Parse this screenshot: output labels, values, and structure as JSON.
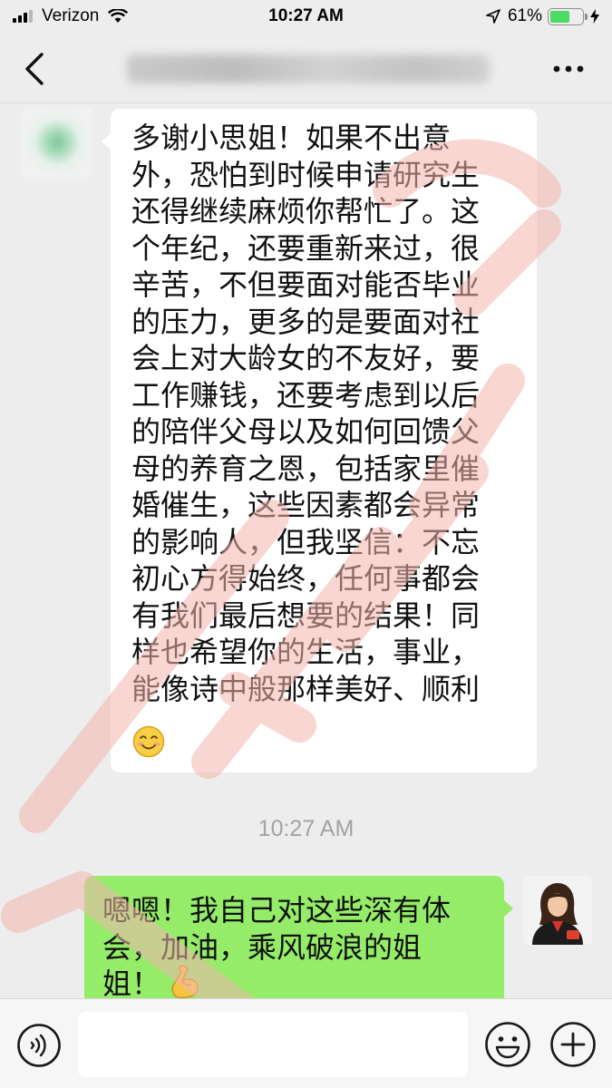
{
  "status_bar": {
    "carrier": "Verizon",
    "time": "10:27 AM",
    "battery_label": "61%",
    "battery_level": 0.61
  },
  "nav": {
    "back_icon": "chevron-left-icon",
    "more_icon": "more-dots-icon"
  },
  "messages": [
    {
      "side": "left",
      "text": "多谢小思姐！如果不出意\n外，恐怕到时候申请研究生\n还得继续麻烦你帮忙了。这\n个年纪，还要重新来过，很\n辛苦，不但要面对能否毕业\n的压力，更多的是要面对社\n会上对大龄女的不友好，要\n工作赚钱，还要考虑到以后\n的陪伴父母以及如何回馈父\n母的养育之恩，包括家里催\n婚催生，这些因素都会异常\n的影响人，但我坚信：不忘\n初心方得始终，任何事都会\n有我们最后想要的结果！同\n样也希望你的生活，事业，\n能像诗中般那样美好、顺利",
      "emoji": "smile-emoji"
    },
    {
      "side": "right",
      "text": "嗯嗯！我自己对这些深有体\n会，加油，乘风破浪的姐\n姐！",
      "emoji": "flexed-biceps-emoji"
    }
  ],
  "timestamp": "10:27 AM",
  "input_bar": {
    "placeholder": "",
    "voice_icon": "voice-icon",
    "emoji_icon": "emoji-icon",
    "plus_icon": "plus-icon"
  },
  "colors": {
    "background": "#ededed",
    "bubble_incoming": "#ffffff",
    "bubble_outgoing": "#95ec69",
    "battery_fill": "#4cd964",
    "watermark": "#f3b6ae"
  }
}
